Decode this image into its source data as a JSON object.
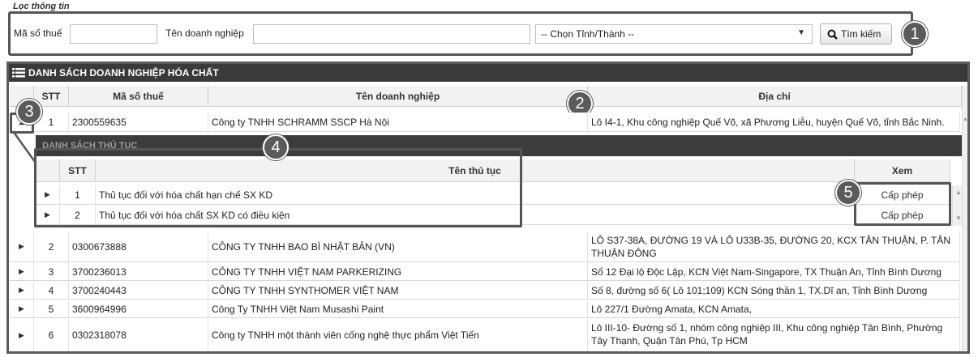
{
  "filter": {
    "title": "Lọc thông tin",
    "tax_label": "Mã số thuế",
    "tax_value": "",
    "name_label": "Tên doanh nghiệp",
    "name_value": "",
    "province_select": "-- Chọn Tỉnh/Thành --",
    "search_button": "Tìm kiếm"
  },
  "callouts": [
    "1",
    "2",
    "3",
    "4",
    "5"
  ],
  "grid": {
    "title": "DANH SÁCH DOANH NGHIỆP HÓA CHẤT",
    "columns": [
      "STT",
      "Mã số thuế",
      "Tên doanh nghiệp",
      "Địa chỉ"
    ],
    "rows": [
      {
        "stt": "1",
        "tax": "2300559635",
        "name": "Công ty TNHH SCHRAMM SSCP Hà Nội",
        "address": "Lô I4-1, Khu công nghiệp Quế Võ, xã Phương Liễu, huyện Quế Võ, tỉnh Bắc Ninh."
      },
      {
        "stt": "2",
        "tax": "0300673888",
        "name": "CÔNG TY TNHH BAO BÌ NHẬT BẢN (VN)",
        "address": "LÔ S37-38A, ĐƯỜNG 19 VÀ LÔ U33B-35, ĐƯỜNG 20, KCX TÂN THUẬN, P. TÂN THUẬN ĐÔNG"
      },
      {
        "stt": "3",
        "tax": "3700236013",
        "name": "CÔNG TY TNHH VIỆT NAM PARKERIZING",
        "address": "Số 12 Đại lộ Độc Lập, KCN Việt Nam-Singapore, TX Thuận An, Tỉnh Bình Dương"
      },
      {
        "stt": "4",
        "tax": "3700240443",
        "name": "CÔNG TY TNHH SYNTHOMER VIỆT NAM",
        "address": "Số 8, đường số 6( Lô 101;109) KCN Sóng thần 1, TX.Dĩ an, Tỉnh Bình Dương"
      },
      {
        "stt": "5",
        "tax": "3600964996",
        "name": "Công Ty TNHH Việt Nam Musashi Paint",
        "address": "Lô 227/1 Đường Amata, KCN Amata,"
      },
      {
        "stt": "6",
        "tax": "0302318078",
        "name": "Công ty TNHH một thành viên cống nghệ thực phẩm Việt Tiến",
        "address": "Lô III-10- Đường số 1, nhóm công nghiệp III, Khu công nghiệp Tân Bình, Phường Tây Thạnh, Quận Tân Phú, Tp HCM"
      }
    ]
  },
  "detail": {
    "title": "DANH SÁCH THỦ TỤC",
    "columns": [
      "STT",
      "Tên thủ tục",
      "Xem"
    ],
    "rows": [
      {
        "stt": "1",
        "name": "Thủ tục đối với hóa chất hạn chế SX KD",
        "action": "Cấp phép"
      },
      {
        "stt": "2",
        "name": "Thủ tục đối với hóa chất SX KD có điều kiện",
        "action": "Cấp phép"
      }
    ]
  }
}
